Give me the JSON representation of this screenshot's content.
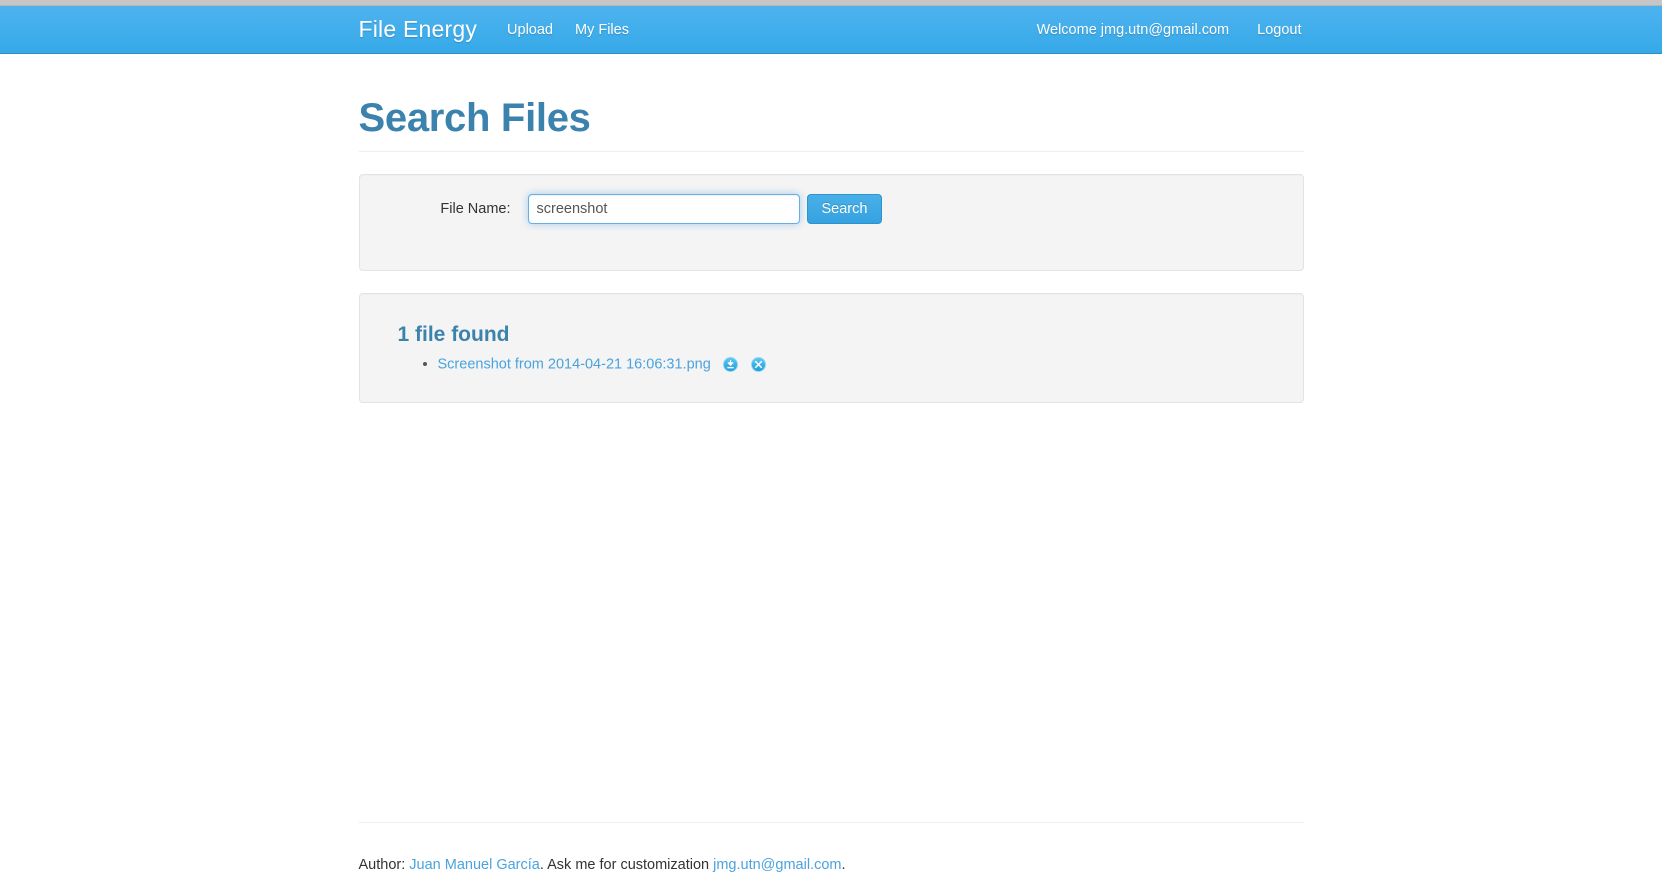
{
  "navbar": {
    "brand": "File Energy",
    "links": [
      {
        "label": "Upload",
        "name": "nav-link-upload"
      },
      {
        "label": "My Files",
        "name": "nav-link-my-files"
      }
    ],
    "welcome": "Welcome jmg.utn@gmail.com",
    "logout": "Logout"
  },
  "page": {
    "title": "Search Files"
  },
  "search": {
    "label": "File Name:",
    "value": "screenshot",
    "placeholder": "",
    "button": "Search"
  },
  "results": {
    "heading": "1 file found",
    "files": [
      {
        "name": "Screenshot from 2014-04-21 16:06:31.png",
        "download_icon": "download-circle-icon",
        "delete_icon": "delete-circle-icon"
      }
    ]
  },
  "footer": {
    "prefix": "Author: ",
    "author": "Juan Manuel García",
    "middle": ". Ask me for customization ",
    "email": "jmg.utn@gmail.com",
    "suffix": "."
  },
  "colors": {
    "brand_blue": "#36a9e8",
    "heading_blue": "#3b83ad",
    "link_blue": "#4aa3df",
    "panel_bg": "#f4f4f4",
    "panel_border": "#e3e3e3",
    "focus_border": "#66afe9"
  }
}
